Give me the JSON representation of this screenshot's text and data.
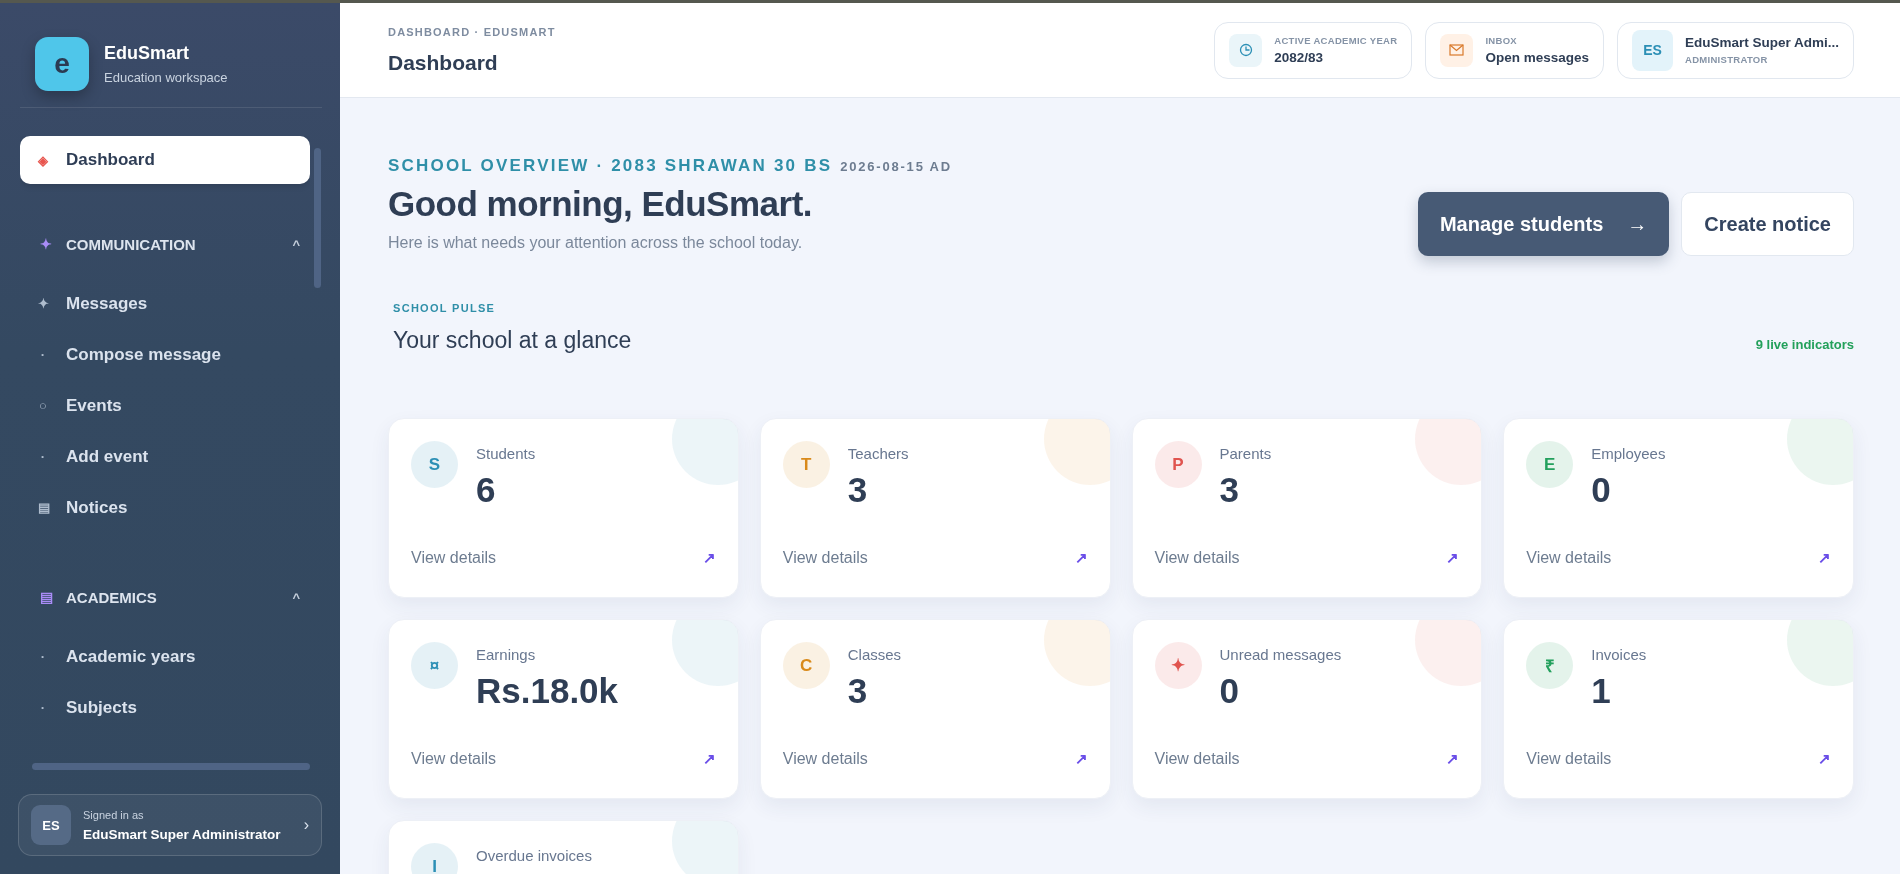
{
  "brand": {
    "logo_letter": "e",
    "name": "EduSmart",
    "subtitle": "Education workspace"
  },
  "sidebar": {
    "items": [
      {
        "icon": "◈",
        "label": "Dashboard",
        "selected": true
      }
    ],
    "sections": [
      {
        "icon": "✦",
        "title": "COMMUNICATION",
        "toggle": "^",
        "expanded": true,
        "items": [
          {
            "icon": "✦",
            "label": "Messages",
            "selected": false
          },
          {
            "icon": "·",
            "label": "Compose message",
            "selected": false
          },
          {
            "icon": "○",
            "label": "Events",
            "selected": false
          },
          {
            "icon": "·",
            "label": "Add event",
            "selected": false
          },
          {
            "icon": "▤",
            "label": "Notices",
            "selected": false
          }
        ]
      },
      {
        "icon": "▤",
        "title": "ACADEMICS",
        "toggle": "^",
        "expanded": true,
        "items": [
          {
            "icon": "·",
            "label": "Academic years",
            "selected": false
          },
          {
            "icon": "·",
            "label": "Subjects",
            "selected": false
          }
        ]
      }
    ],
    "user": {
      "initials": "ES",
      "caption": "Signed in as",
      "name": "EduSmart Super Administrator",
      "chevron": "›"
    }
  },
  "header": {
    "breadcrumb": "DASHBOARD · EDUSMART",
    "title": "Dashboard",
    "pills": [
      {
        "kind": "year",
        "label": "ACTIVE ACADEMIC YEAR",
        "value": "2082/83"
      },
      {
        "kind": "inbox",
        "label": "INBOX",
        "value": "Open messages"
      },
      {
        "kind": "user",
        "initials": "ES",
        "value": "EduSmart Super Admi...",
        "label": "ADMINISTRATOR"
      }
    ]
  },
  "overview": {
    "eyebrow": "SCHOOL OVERVIEW · 2083 SHRAWAN 30 BS",
    "date": "2026-08-15 AD",
    "greeting": "Good morning, EduSmart.",
    "subtitle": "Here is what needs your attention across the school today.",
    "primary_button": {
      "label": "Manage students",
      "arrow": "→"
    },
    "secondary_button": {
      "label": "Create notice"
    }
  },
  "pulse": {
    "eyebrow": "SCHOOL PULSE",
    "title": "Your school at a glance",
    "indicator": "9 live indicators",
    "cards": [
      {
        "glyph": "S",
        "label": "Students",
        "value": "6",
        "link": "View details",
        "link_icon": "↗",
        "color": "#2b8fb5"
      },
      {
        "glyph": "T",
        "label": "Teachers",
        "value": "3",
        "link": "View details",
        "link_icon": "↗",
        "color": "#d98a1a"
      },
      {
        "glyph": "P",
        "label": "Parents",
        "value": "3",
        "link": "View details",
        "link_icon": "↗",
        "color": "#e0544f"
      },
      {
        "glyph": "E",
        "label": "Employees",
        "value": "0",
        "link": "View details",
        "link_icon": "↗",
        "color": "#23a05d"
      },
      {
        "glyph": "¤",
        "label": "Earnings",
        "value": "Rs.18.0k",
        "link": "View details",
        "link_icon": "↗",
        "color": "#2b8fb5"
      },
      {
        "glyph": "C",
        "label": "Classes",
        "value": "3",
        "link": "View details",
        "link_icon": "↗",
        "color": "#d98a1a"
      },
      {
        "glyph": "✦",
        "label": "Unread messages",
        "value": "0",
        "link": "View details",
        "link_icon": "↗",
        "color": "#e0544f"
      },
      {
        "glyph": "₹",
        "label": "Invoices",
        "value": "1",
        "link": "View details",
        "link_icon": "↗",
        "color": "#23a05d"
      },
      {
        "glyph": "I",
        "label": "Overdue invoices",
        "color": "#2b8fb5"
      }
    ]
  }
}
